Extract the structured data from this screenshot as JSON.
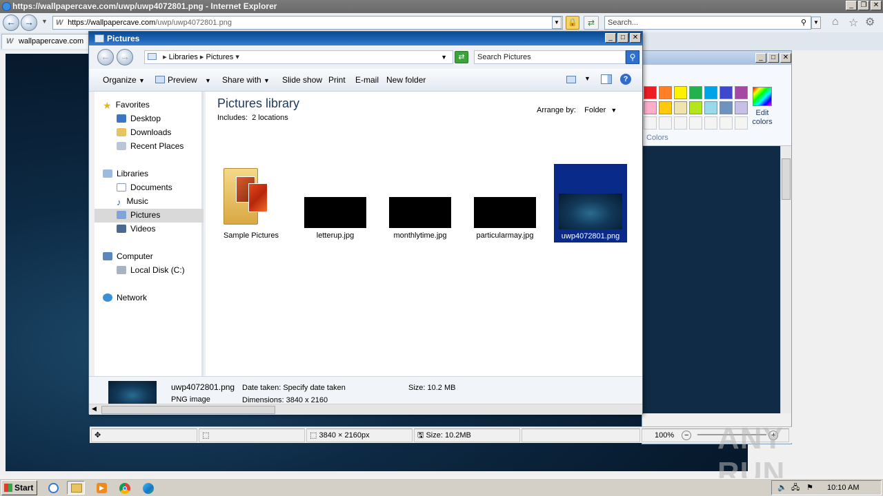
{
  "browser": {
    "window_title": "https://wallpapercave.com/uwp/uwp4072801.png - Internet Explorer",
    "url_prefix": "https://wallpapercave.com",
    "url_path": "/uwp/uwp4072801.png",
    "search_placeholder": "Search...",
    "tab_title": "wallpapercave.com"
  },
  "explorer": {
    "window_title": "Pictures",
    "breadcrumb": [
      "Libraries",
      "Pictures"
    ],
    "search_placeholder": "Search Pictures",
    "toolbar": {
      "organize": "Organize",
      "preview": "Preview",
      "share_with": "Share with",
      "slide_show": "Slide show",
      "print": "Print",
      "email": "E-mail",
      "new_folder": "New folder"
    },
    "nav_tree": {
      "favorites": "Favorites",
      "desktop": "Desktop",
      "downloads": "Downloads",
      "recent_places": "Recent Places",
      "libraries": "Libraries",
      "documents": "Documents",
      "music": "Music",
      "pictures": "Pictures",
      "videos": "Videos",
      "computer": "Computer",
      "local_disk": "Local Disk (C:)",
      "network": "Network"
    },
    "library": {
      "title": "Pictures library",
      "includes_label": "Includes:",
      "includes_value": "2 locations",
      "arrange_label": "Arrange by:",
      "arrange_value": "Folder"
    },
    "files": [
      {
        "name": "Sample Pictures"
      },
      {
        "name": "letterup.jpg"
      },
      {
        "name": "monthlytime.jpg"
      },
      {
        "name": "particularmay.jpg"
      },
      {
        "name": "uwp4072801.png"
      }
    ],
    "details": {
      "file_name": "uwp4072801.png",
      "file_type": "PNG image",
      "date_taken": "Date taken: Specify date taken",
      "dimensions": "Dimensions: 3840 x 2160",
      "size": "Size: 10.2 MB"
    }
  },
  "paint": {
    "edit_colors_line1": "Edit",
    "edit_colors_line2": "colors",
    "colors_label": "Colors",
    "palette_row1": [
      "#ed1c24",
      "#ff7f27",
      "#fff200",
      "#22b14c",
      "#00a2e8",
      "#3f48cc",
      "#a349a4"
    ],
    "palette_row2": [
      "#ffaec9",
      "#ffc90e",
      "#efe4b0",
      "#b5e61d",
      "#99d9ea",
      "#7092be",
      "#c8bfe7"
    ]
  },
  "viewer_status": {
    "dimensions": "3840 × 2160px",
    "size": "Size: 10.2MB",
    "zoom": "100%"
  },
  "watermark": "ANY RUN",
  "taskbar": {
    "start_label": "Start",
    "clock": "10:10 AM"
  }
}
